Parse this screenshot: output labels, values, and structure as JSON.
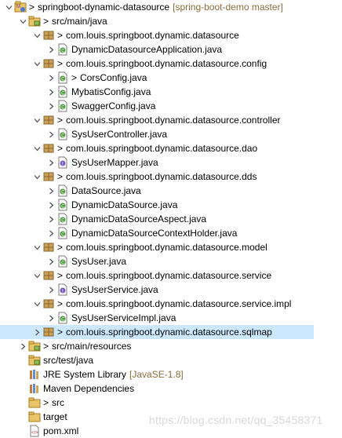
{
  "tree": [
    {
      "depth": 0,
      "expanded": true,
      "icon": "maven-project-icon",
      "prefix": ">",
      "label": "springboot-dynamic-datasource",
      "decoration": "[spring-boot-demo master]"
    },
    {
      "depth": 1,
      "expanded": true,
      "icon": "source-folder-icon",
      "prefix": ">",
      "label": "src/main/java"
    },
    {
      "depth": 2,
      "expanded": true,
      "icon": "package-icon",
      "prefix": ">",
      "label": "com.louis.springboot.dynamic.datasource"
    },
    {
      "depth": 3,
      "expanded": false,
      "icon": "java-file-icon",
      "prefix": "",
      "label": "DynamicDatasourceApplication.java"
    },
    {
      "depth": 2,
      "expanded": true,
      "icon": "package-icon",
      "prefix": ">",
      "label": "com.louis.springboot.dynamic.datasource.config"
    },
    {
      "depth": 3,
      "expanded": false,
      "icon": "java-file-icon",
      "prefix": ">",
      "label": "CorsConfig.java"
    },
    {
      "depth": 3,
      "expanded": false,
      "icon": "java-file-icon",
      "prefix": "",
      "label": "MybatisConfig.java"
    },
    {
      "depth": 3,
      "expanded": false,
      "icon": "java-file-icon",
      "prefix": "",
      "label": "SwaggerConfig.java"
    },
    {
      "depth": 2,
      "expanded": true,
      "icon": "package-icon",
      "prefix": ">",
      "label": "com.louis.springboot.dynamic.datasource.controller"
    },
    {
      "depth": 3,
      "expanded": false,
      "icon": "java-file-icon",
      "prefix": "",
      "label": "SysUserController.java"
    },
    {
      "depth": 2,
      "expanded": true,
      "icon": "package-icon",
      "prefix": ">",
      "label": "com.louis.springboot.dynamic.datasource.dao"
    },
    {
      "depth": 3,
      "expanded": false,
      "icon": "java-interface-icon",
      "prefix": "",
      "label": "SysUserMapper.java"
    },
    {
      "depth": 2,
      "expanded": true,
      "icon": "package-icon",
      "prefix": ">",
      "label": "com.louis.springboot.dynamic.datasource.dds"
    },
    {
      "depth": 3,
      "expanded": false,
      "icon": "java-file-icon",
      "prefix": "",
      "label": "DataSource.java"
    },
    {
      "depth": 3,
      "expanded": false,
      "icon": "java-file-icon",
      "prefix": "",
      "label": "DynamicDataSource.java"
    },
    {
      "depth": 3,
      "expanded": false,
      "icon": "java-file-icon",
      "prefix": "",
      "label": "DynamicDataSourceAspect.java"
    },
    {
      "depth": 3,
      "expanded": false,
      "icon": "java-file-icon",
      "prefix": "",
      "label": "DynamicDataSourceContextHolder.java"
    },
    {
      "depth": 2,
      "expanded": true,
      "icon": "package-icon",
      "prefix": ">",
      "label": "com.louis.springboot.dynamic.datasource.model"
    },
    {
      "depth": 3,
      "expanded": false,
      "icon": "java-file-icon",
      "prefix": "",
      "label": "SysUser.java"
    },
    {
      "depth": 2,
      "expanded": true,
      "icon": "package-icon",
      "prefix": ">",
      "label": "com.louis.springboot.dynamic.datasource.service"
    },
    {
      "depth": 3,
      "expanded": false,
      "icon": "java-interface-icon",
      "prefix": "",
      "label": "SysUserService.java"
    },
    {
      "depth": 2,
      "expanded": true,
      "icon": "package-icon",
      "prefix": ">",
      "label": "com.louis.springboot.dynamic.datasource.service.impl"
    },
    {
      "depth": 3,
      "expanded": false,
      "icon": "java-file-icon",
      "prefix": "",
      "label": "SysUserServiceImpl.java"
    },
    {
      "depth": 2,
      "expanded": false,
      "icon": "package-icon",
      "prefix": ">",
      "label": "com.louis.springboot.dynamic.datasource.sqlmap",
      "selected": true
    },
    {
      "depth": 1,
      "expanded": false,
      "icon": "source-folder-icon",
      "prefix": ">",
      "label": "src/main/resources"
    },
    {
      "depth": 1,
      "expanded": false,
      "icon": "source-folder-icon",
      "prefix": "",
      "label": "src/test/java",
      "notoggle": true
    },
    {
      "depth": 1,
      "expanded": false,
      "icon": "library-icon",
      "prefix": "",
      "label": "JRE System Library",
      "decoration": "[JavaSE-1.8]",
      "notoggle": true
    },
    {
      "depth": 1,
      "expanded": false,
      "icon": "library-icon",
      "prefix": "",
      "label": "Maven Dependencies",
      "notoggle": true
    },
    {
      "depth": 1,
      "expanded": false,
      "icon": "folder-icon",
      "prefix": ">",
      "label": "src",
      "notoggle": true
    },
    {
      "depth": 1,
      "expanded": false,
      "icon": "folder-icon",
      "prefix": "",
      "label": "target",
      "notoggle": true
    },
    {
      "depth": 1,
      "expanded": false,
      "icon": "xml-file-icon",
      "prefix": "",
      "label": "pom.xml",
      "notoggle": true
    }
  ],
  "watermark": "https://blog.csdn.net/qq_35458371"
}
